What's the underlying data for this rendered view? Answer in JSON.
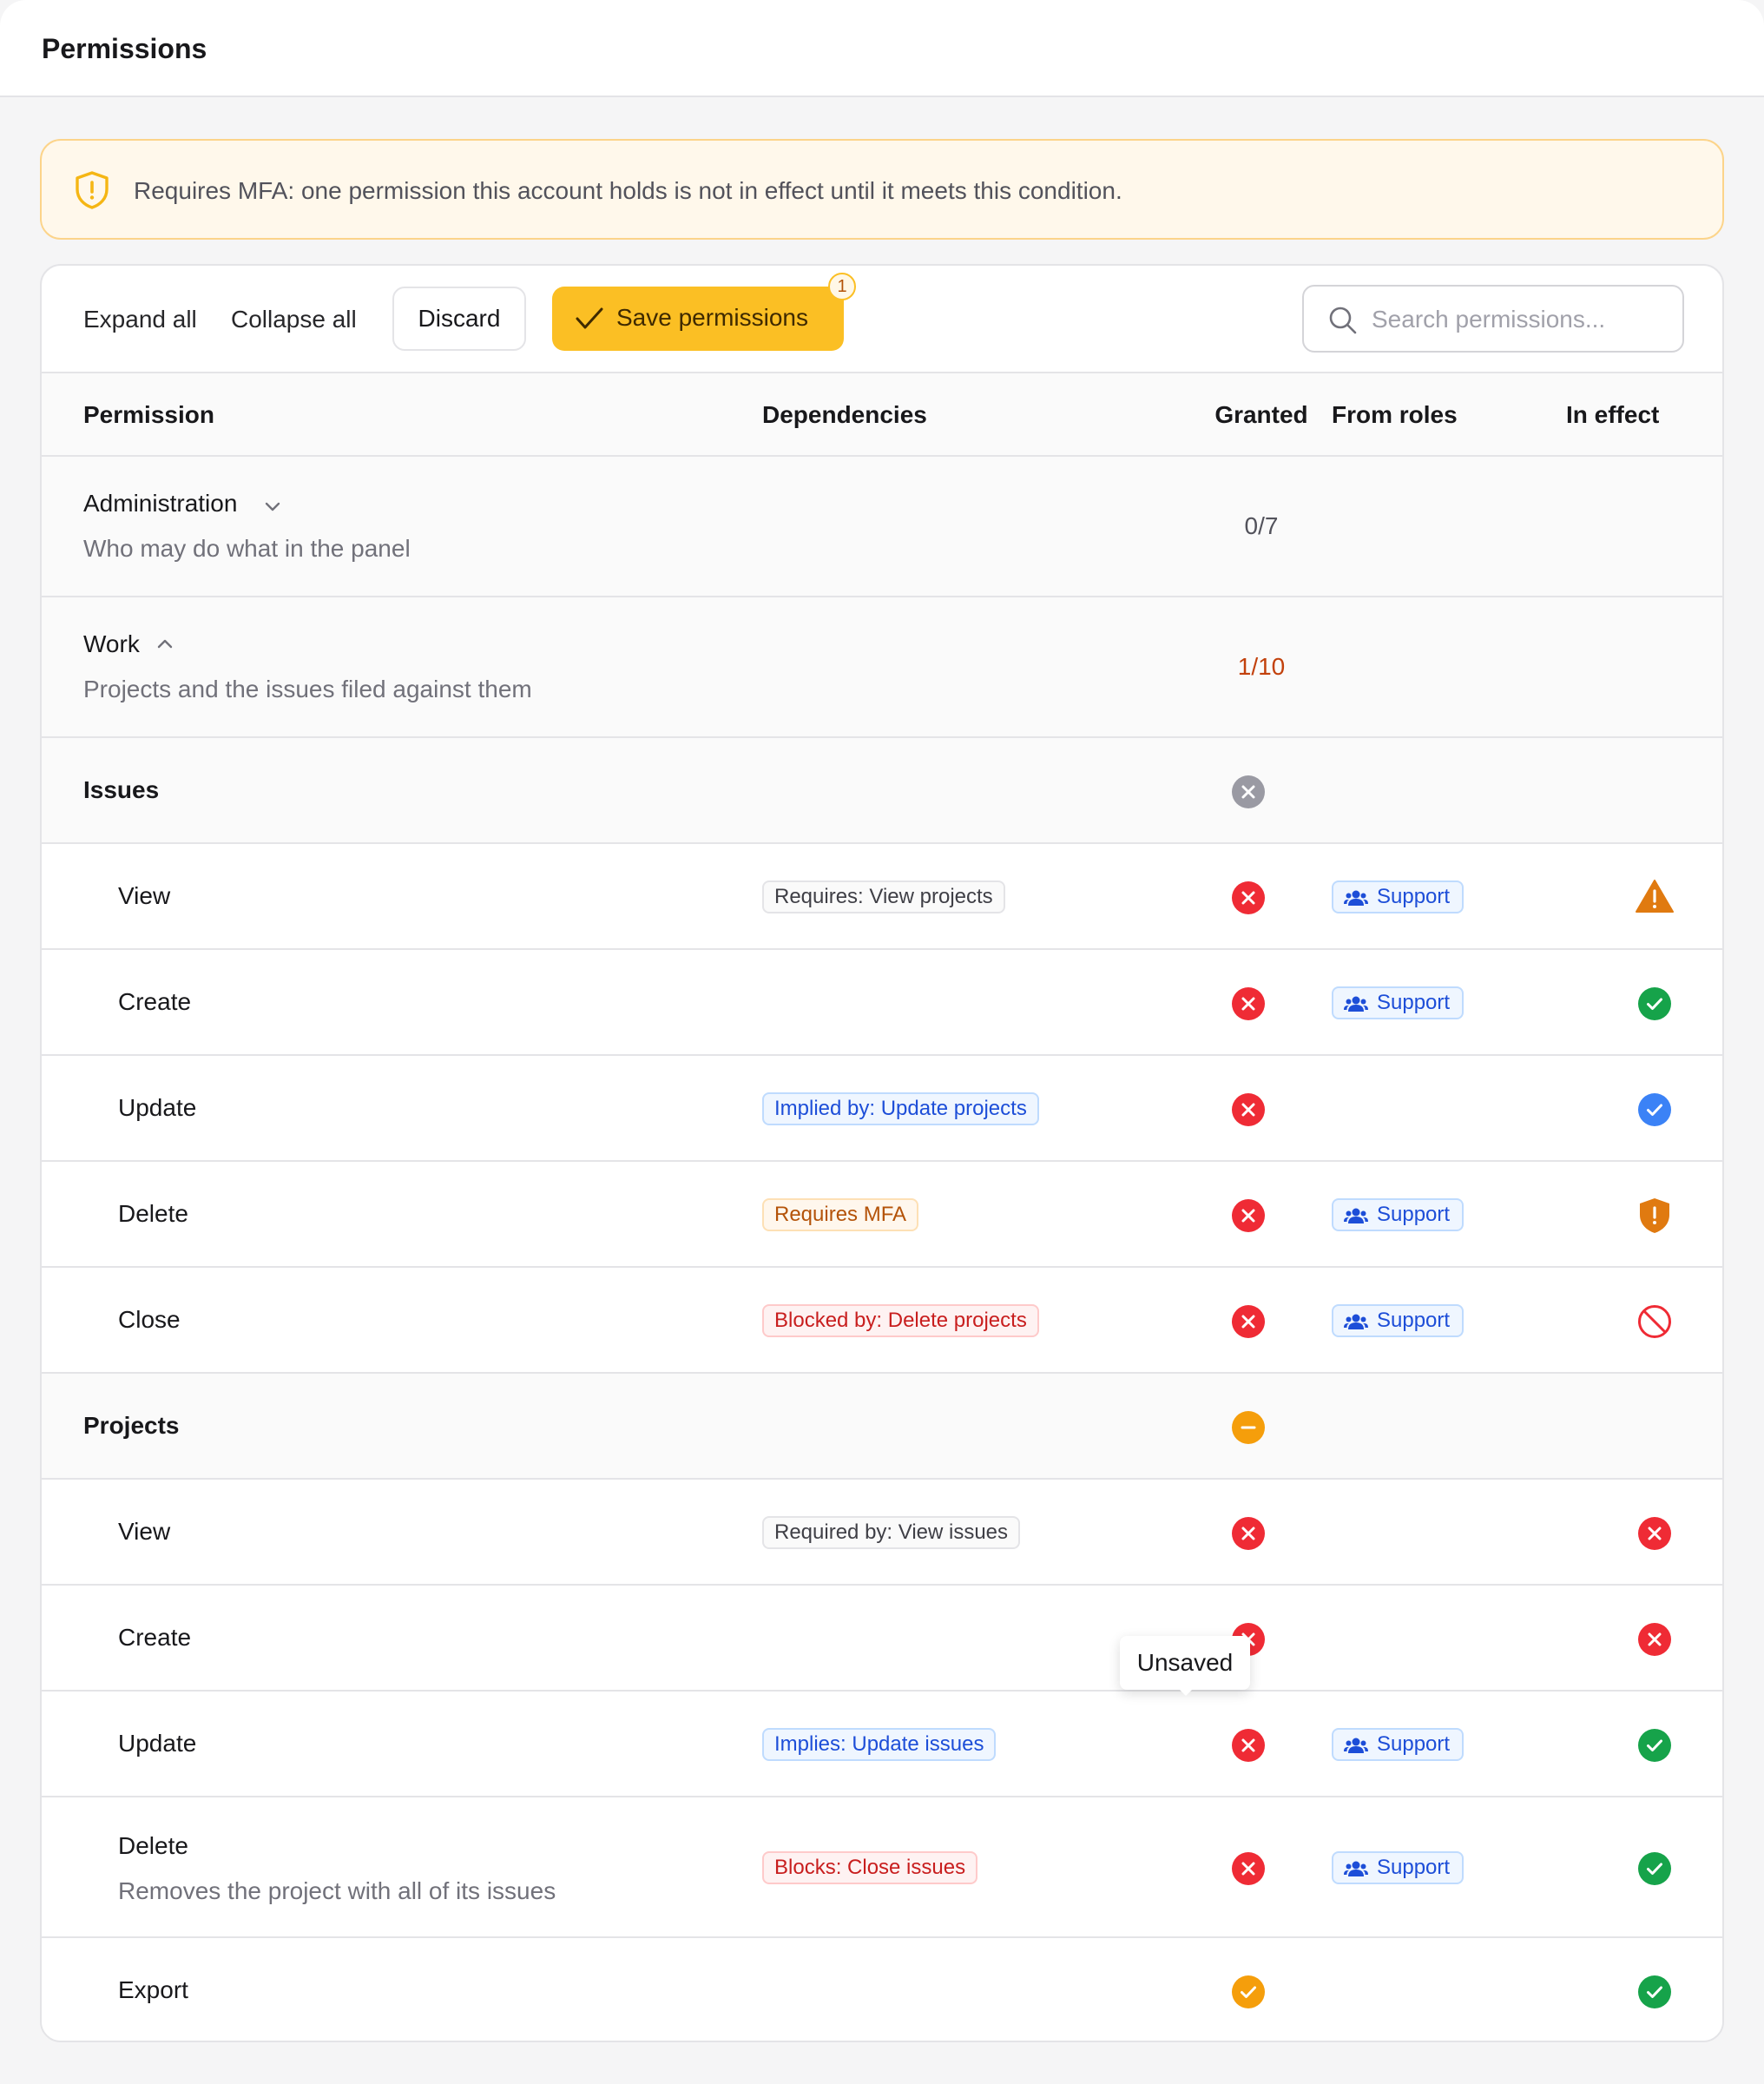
{
  "header": {
    "title": "Permissions"
  },
  "banner": {
    "icon": "shield-alert-icon",
    "text": "Requires MFA: one permission this account holds is not in effect until it meets this condition."
  },
  "toolbar": {
    "expand_all": "Expand all",
    "collapse_all": "Collapse all",
    "discard": "Discard",
    "save": "Save permissions",
    "save_badge": "1",
    "search_placeholder": "Search permissions..."
  },
  "table": {
    "columns": [
      "Permission",
      "Dependencies",
      "Granted",
      "From roles",
      "In effect"
    ]
  },
  "groups": [
    {
      "name": "Administration",
      "description": "Who may do what in the panel",
      "count": "0/7",
      "expanded": false
    },
    {
      "name": "Work",
      "description": "Projects and the issues filed against them",
      "count": "1/10",
      "expanded": true
    }
  ],
  "sections": [
    {
      "name": "Issues",
      "granted": "none",
      "items": [
        {
          "name": "View",
          "dependency": "Requires: View projects",
          "dep_style": "neutral",
          "granted": "no",
          "role": "Support",
          "effect": "warning"
        },
        {
          "name": "Create",
          "dependency": "",
          "dep_style": "",
          "granted": "no",
          "role": "Support",
          "effect": "granted"
        },
        {
          "name": "Update",
          "dependency": "Implied by: Update projects",
          "dep_style": "blue",
          "granted": "no",
          "role": "",
          "effect": "implied"
        },
        {
          "name": "Delete",
          "dependency": "Requires MFA",
          "dep_style": "amber",
          "granted": "no",
          "role": "Support",
          "effect": "requires-mfa"
        },
        {
          "name": "Close",
          "dependency": "Blocked by: Delete projects",
          "dep_style": "red",
          "granted": "no",
          "role": "Support",
          "effect": "blocked"
        }
      ]
    },
    {
      "name": "Projects",
      "granted": "partial",
      "items": [
        {
          "name": "View",
          "dependency": "Required by: View issues",
          "dep_style": "neutral",
          "granted": "no",
          "role": "",
          "effect": "denied"
        },
        {
          "name": "Create",
          "dependency": "",
          "dep_style": "",
          "granted": "no",
          "role": "",
          "effect": "denied"
        },
        {
          "name": "Update",
          "dependency": "Implies: Update issues",
          "dep_style": "blue",
          "granted": "no",
          "role": "Support",
          "effect": "granted"
        },
        {
          "name": "Delete",
          "description": "Removes the project with all of its issues",
          "dependency": "Blocks: Close issues",
          "dep_style": "red",
          "granted": "no",
          "role": "Support",
          "effect": "granted"
        },
        {
          "name": "Export",
          "dependency": "",
          "dep_style": "",
          "granted": "unsaved-yes",
          "role": "",
          "effect": "granted"
        }
      ]
    }
  ],
  "tooltip": {
    "text": "Unsaved"
  },
  "colors": {
    "accent": "#fbbf24",
    "denied": "#ef2b35",
    "granted": "#16a34a",
    "implied": "#3b82f6",
    "warning": "#e07a10",
    "muted": "#9a9aa3"
  }
}
